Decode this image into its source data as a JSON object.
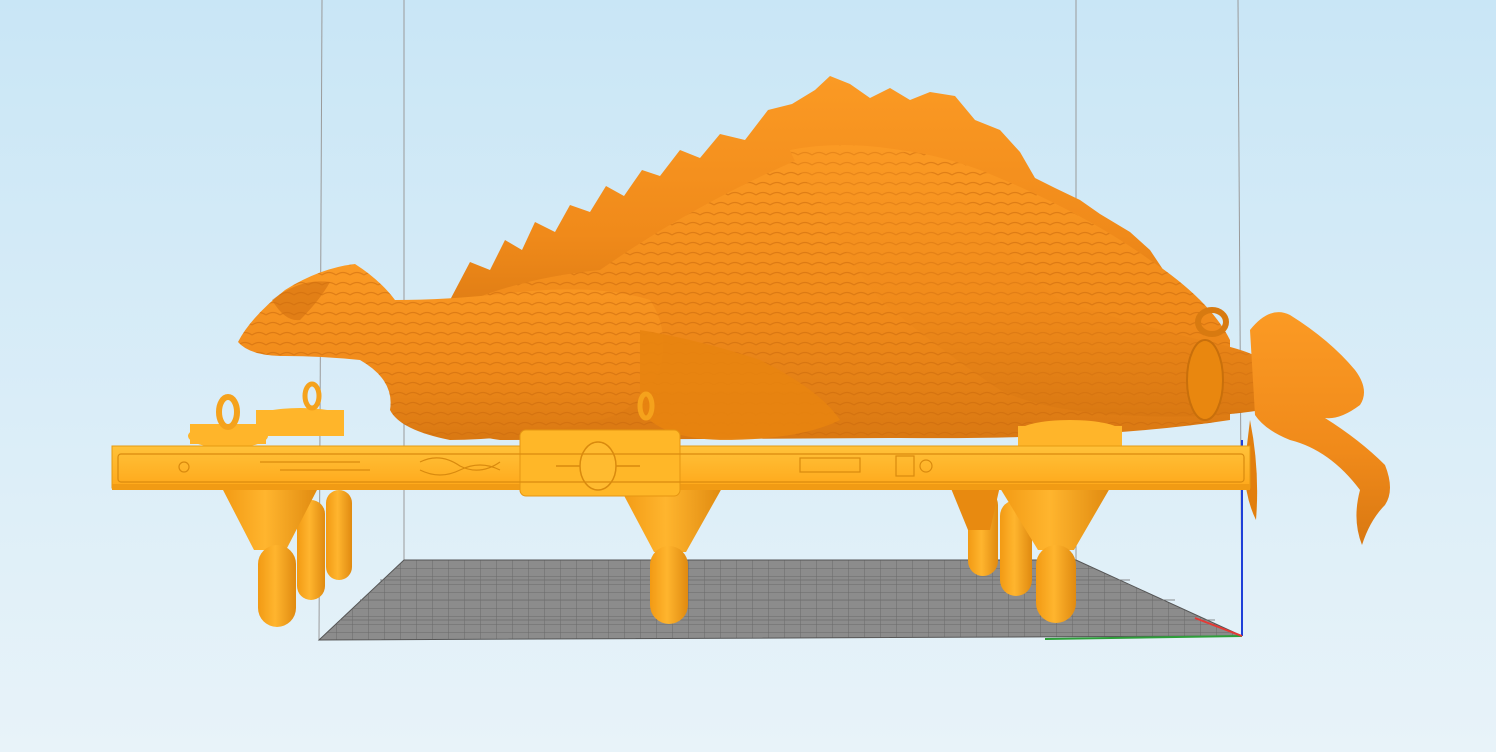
{
  "viewport": {
    "background_top": "#c9e6f6",
    "background_bottom": "#e8f3f9",
    "model_color": "#f7931e",
    "model_color_light": "#ffa726",
    "model_color_dark": "#d2700e",
    "plate_color": "#ffb020",
    "bed_color": "#8e8e8e",
    "bed_grid_color": "#6f6f6f",
    "guide_line_color": "#9a9a9a",
    "axes": {
      "x_color": "#e53935",
      "y_color": "#2e9e3a",
      "z_color": "#1e3fd8"
    }
  },
  "objects": [
    {
      "name": "creature-model",
      "icon": "3d-model-icon"
    },
    {
      "name": "support-plate",
      "icon": "support-raft-icon"
    },
    {
      "name": "build-plate",
      "icon": "grid-bed-icon"
    }
  ]
}
